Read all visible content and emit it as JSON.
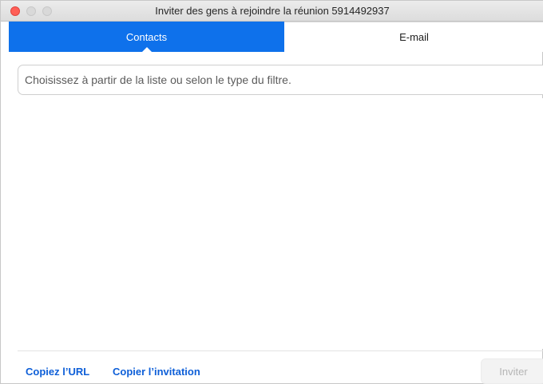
{
  "window": {
    "title": "Inviter des gens à rejoindre la réunion 5914492937"
  },
  "tabs": [
    {
      "label": "Contacts",
      "selected": true
    },
    {
      "label": "E-mail",
      "selected": false
    }
  ],
  "search": {
    "placeholder": "Choisissez à partir de la liste ou selon le type du filtre.",
    "value": ""
  },
  "footer": {
    "copy_url_label": "Copiez l’URL",
    "copy_invitation_label": "Copier l’invitation",
    "invite_label": "Inviter"
  },
  "colors": {
    "accent": "#0e71eb",
    "link": "#0e5fd8",
    "close_button": "#ff5f57"
  }
}
